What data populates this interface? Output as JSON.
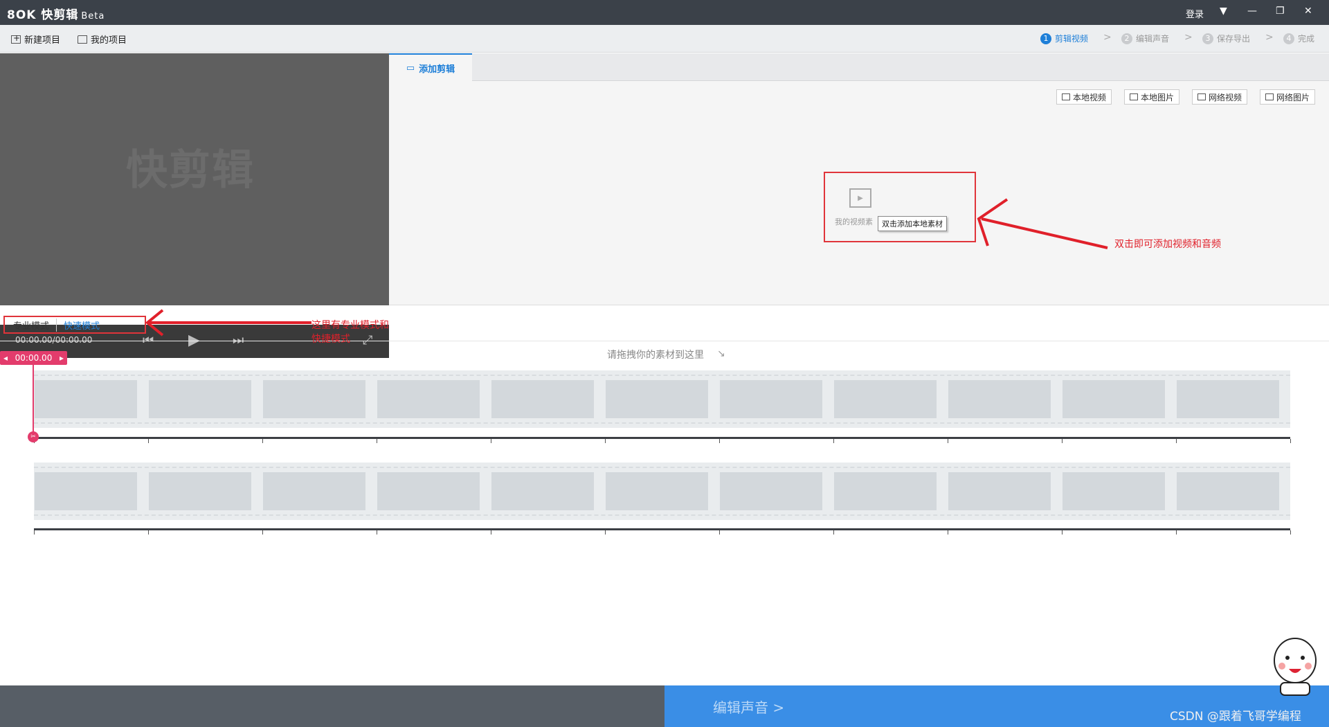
{
  "app": {
    "logo": "8OK 快剪辑",
    "beta": "Beta",
    "login": "登录"
  },
  "window_controls": {
    "menu": "▼",
    "minimize": "—",
    "restore": "❐",
    "close": "✕"
  },
  "toolbar": {
    "new_project": "新建项目",
    "my_projects": "我的项目"
  },
  "steps": [
    {
      "num": "1",
      "label": "剪辑视频",
      "active": true
    },
    {
      "num": "2",
      "label": "编辑声音",
      "active": false
    },
    {
      "num": "3",
      "label": "保存导出",
      "active": false
    },
    {
      "num": "4",
      "label": "完成",
      "active": false
    }
  ],
  "step_arrow": ">",
  "preview": {
    "watermark": "快剪辑",
    "timecode": "00:00.00/00:00.00"
  },
  "materials": {
    "tab": "添加剪辑",
    "sources": [
      "本地视频",
      "本地图片",
      "网络视频",
      "网络图片"
    ],
    "my_video": "我的视频素",
    "tooltip": "双击添加本地素材"
  },
  "annotations": {
    "add": "双击即可添加视频和音频",
    "mode_line1": "这里有专业模式和",
    "mode_line2": "快捷模式"
  },
  "modes": {
    "pro": "专业模式",
    "fast": "快速模式"
  },
  "timeline": {
    "drop_hint": "请拖拽你的素材到这里",
    "playhead_time": "00:00.00"
  },
  "footer": {
    "next_button": "编辑声音 >",
    "watermark": "CSDN @跟着飞哥学编程"
  },
  "colors": {
    "accent": "#1e7fd8",
    "playhead": "#e33c6c",
    "annotation": "#e0202a",
    "next_bar": "#3a8ee6"
  }
}
